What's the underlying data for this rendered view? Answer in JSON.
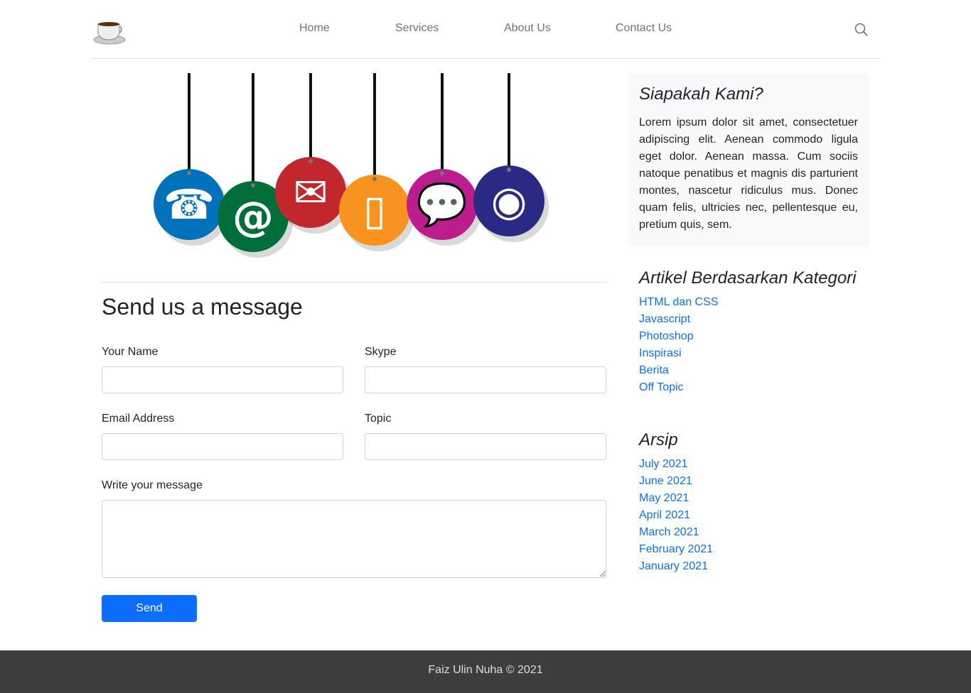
{
  "nav": {
    "items": [
      "Home",
      "Services",
      "About Us",
      "Contact Us"
    ]
  },
  "form": {
    "title": "Send us a message",
    "name_label": "Your Name",
    "skype_label": "Skype",
    "email_label": "Email Address",
    "topic_label": "Topic",
    "message_label": "Write your message",
    "send_label": "Send"
  },
  "about": {
    "title": "Siapakah Kami?",
    "text": "Lorem ipsum dolor sit amet, consectetuer adipiscing elit. Aenean commodo ligula eget dolor. Aenean massa. Cum sociis natoque penatibus et magnis dis parturient montes, nascetur ridiculus mus. Donec quam felis, ultricies nec, pellentesque eu, pretium quis, sem."
  },
  "categories": {
    "title": "Artikel Berdasarkan Kategori",
    "items": [
      "HTML dan CSS",
      "Javascript",
      "Photoshop",
      "Inspirasi",
      "Berita",
      "Off Topic"
    ]
  },
  "archive": {
    "title": "Arsip",
    "items": [
      "July 2021",
      "June 2021",
      "May 2021",
      "April 2021",
      "March 2021",
      "February 2021",
      "January 2021"
    ]
  },
  "footer": {
    "text": "Faiz Ulin Nuha © 2021"
  },
  "colors": {
    "accent": "#0d6efd",
    "footer": "#3d3d3d",
    "tags": [
      "#0071bb",
      "#006e3a",
      "#c1272d",
      "#f7931e",
      "#bb1d8f",
      "#2a2a85"
    ]
  }
}
